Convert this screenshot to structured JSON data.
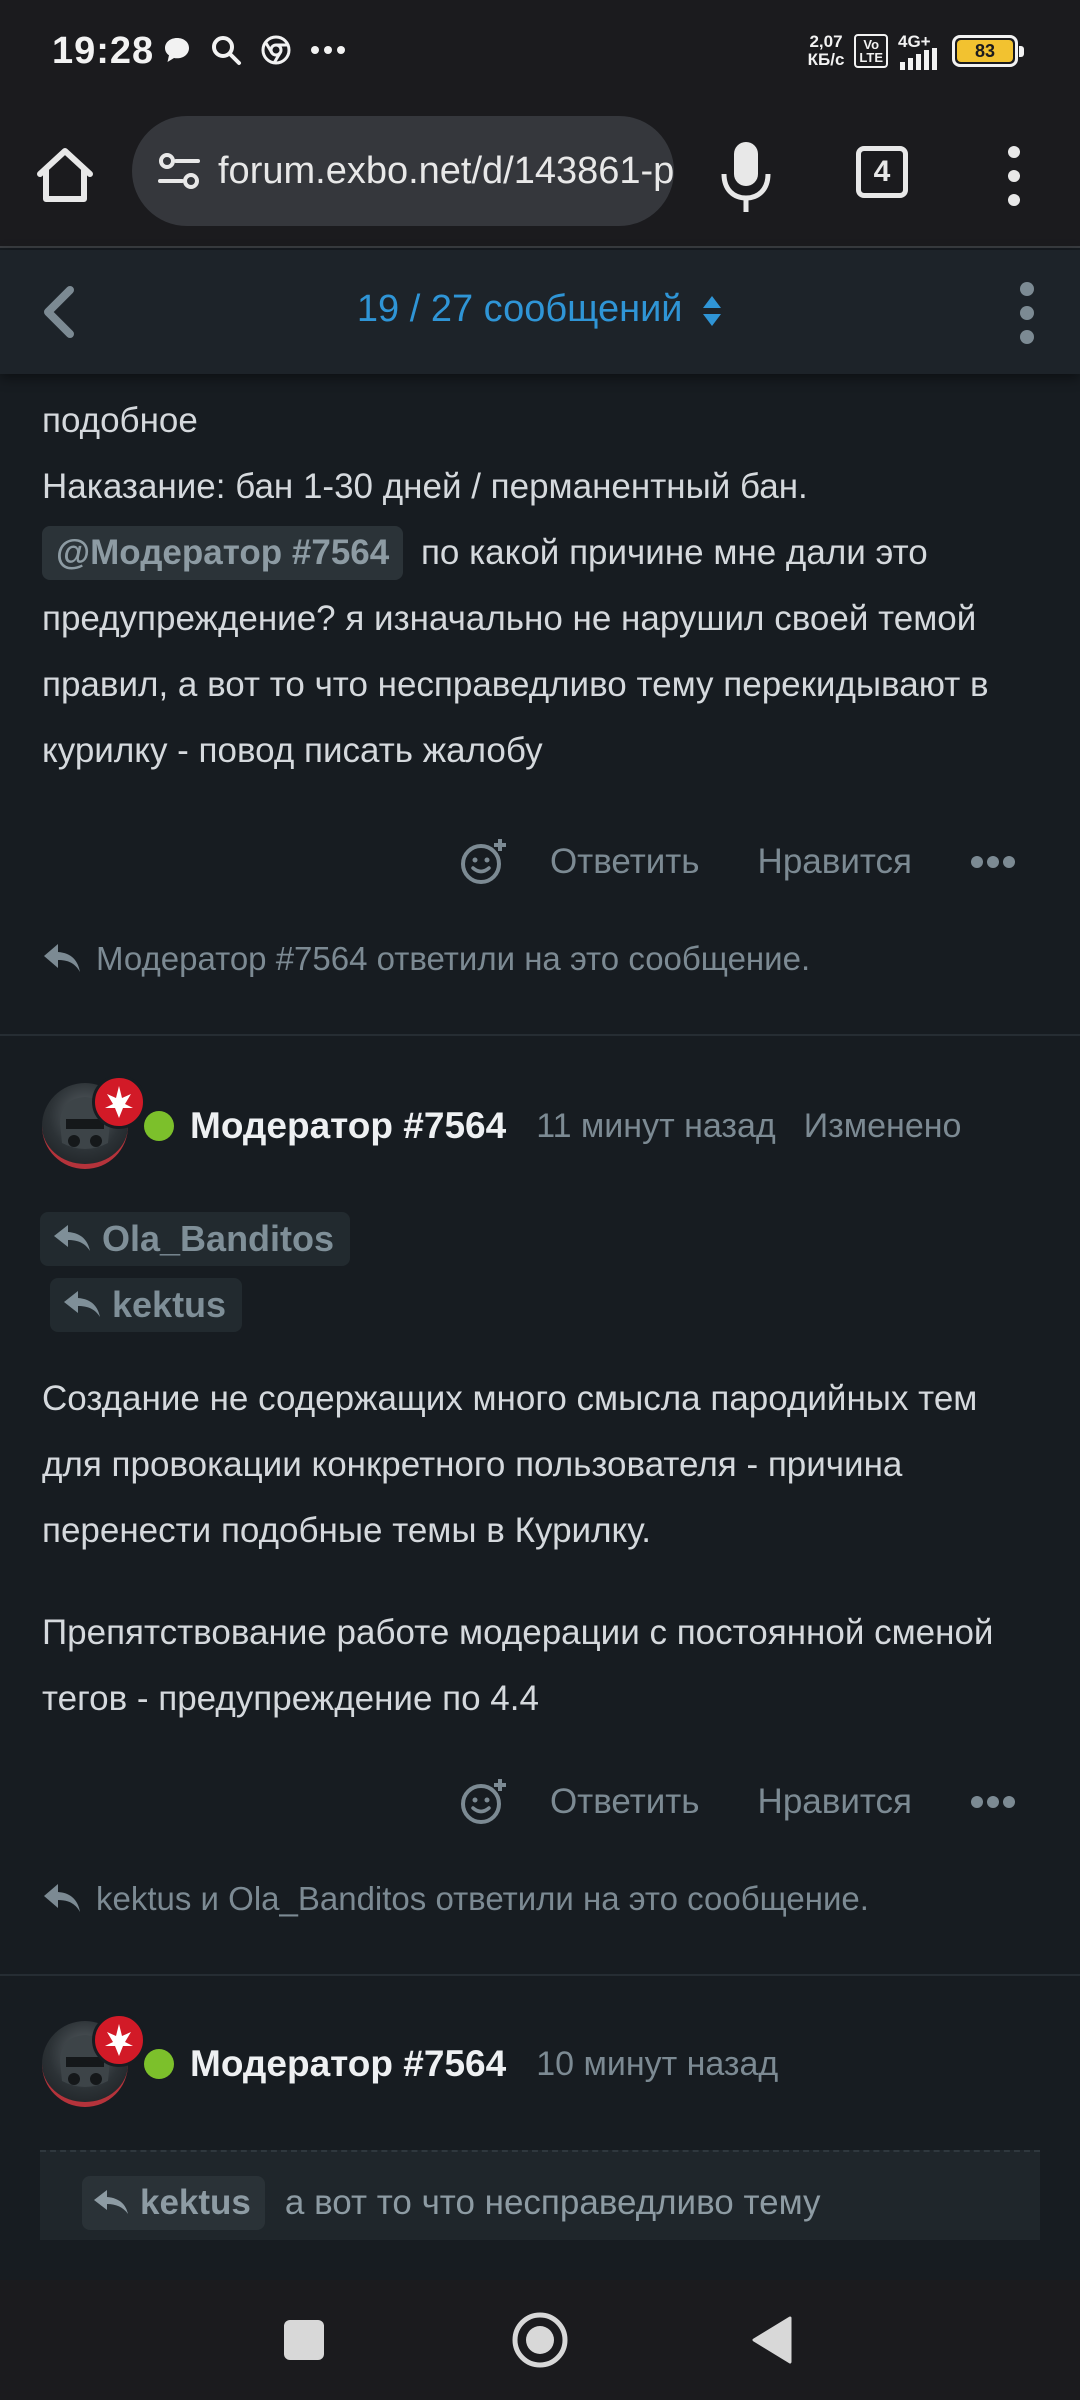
{
  "status_bar": {
    "time": "19:28",
    "speed_value": "2,07",
    "speed_unit": "КБ/с",
    "volte_top": "Vo",
    "volte_bottom": "LTE",
    "network": "4G+",
    "battery": "83"
  },
  "browser": {
    "url": "forum.exbo.net/d/143861-p",
    "tab_count": "4"
  },
  "topic_bar": {
    "counter": "19 / 27 сообщений"
  },
  "post_top": {
    "lines": [
      "подобное",
      "Наказание: бан 1-30 дней / перманентный бан."
    ],
    "mention": "@Модератор #7564",
    "text_after_mention": " по какой причине мне дали это предупреждение? я изначально не нарушил своей темой правил, а вот то что несправедливо тему перекидывают в курилку - повод писать жалобу",
    "actions": {
      "reply": "Ответить",
      "like": "Нравится"
    },
    "replied": "Модератор #7564 ответили на это сообщение."
  },
  "post_middle": {
    "username": "Модератор #7564",
    "time": "11 минут назад",
    "edited": "Изменено",
    "reply_to": [
      "Ola_Banditos",
      "kektus"
    ],
    "paragraphs": [
      "Создание не содержащих много смысла пародийных тем для провокации конкретного пользователя - причина перенести подобные темы в Курилку.",
      "Препятствование работе модерации с постоянной сменой тегов - предупреждение по 4.4"
    ],
    "actions": {
      "reply": "Ответить",
      "like": "Нравится"
    },
    "replied": "kektus и Ola_Banditos ответили на это сообщение."
  },
  "post_bottom": {
    "username": "Модератор #7564",
    "time": "10 минут назад",
    "quote_user": "kektus",
    "quote_text": "а вот то что несправедливо тему"
  },
  "colors": {
    "background": "#171c21",
    "accent": "#2f95d6",
    "online": "#7cc02b",
    "badge": "#d21a27",
    "muted": "#7c8a93"
  },
  "icons": [
    "home-icon",
    "site-settings-icon",
    "mic-icon",
    "tabs-icon",
    "more-vert-icon",
    "chevron-left-icon",
    "sort-arrows-icon",
    "add-reaction-icon",
    "more-horiz-icon",
    "reply-icon",
    "nav-square-icon",
    "nav-home-icon",
    "nav-back-icon"
  ]
}
